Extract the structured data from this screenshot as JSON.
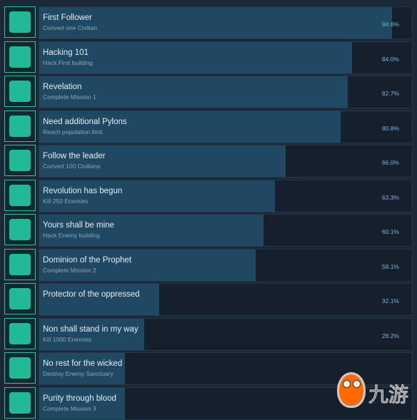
{
  "achievements": [
    {
      "title": "First Follower",
      "desc": "Convert one Civilian",
      "percent_label": "94.6%",
      "percent": 94.6,
      "icon": "spiral-head-icon"
    },
    {
      "title": "Hacking 101",
      "desc": "Hack First building",
      "percent_label": "84.0%",
      "percent": 84.0,
      "icon": "usb-stick-icon"
    },
    {
      "title": "Revelation",
      "desc": "Complete Mission 1",
      "percent_label": "82.7%",
      "percent": 82.7,
      "icon": "prophet-icon"
    },
    {
      "title": "Need additional Pylons",
      "desc": "Reach population limit",
      "percent_label": "80.8%",
      "percent": 80.8,
      "icon": "population-icon"
    },
    {
      "title": "Follow the leader",
      "desc": "Convert 100 Civilians",
      "percent_label": "66.0%",
      "percent": 66.0,
      "icon": "leader-icon"
    },
    {
      "title": "Revolution has begun",
      "desc": "Kill 250 Enemies",
      "percent_label": "63.3%",
      "percent": 63.3,
      "icon": "fist-icon"
    },
    {
      "title": "Yours shall be mine",
      "desc": "Hack Enemy building",
      "percent_label": "60.1%",
      "percent": 60.1,
      "icon": "chevron-shield-icon"
    },
    {
      "title": "Dominion of the Prophet",
      "desc": "Complete Mission 2",
      "percent_label": "58.1%",
      "percent": 58.1,
      "icon": "dominion-icon"
    },
    {
      "title": "Protector of the oppressed",
      "desc": "",
      "percent_label": "32.1%",
      "percent": 32.1,
      "icon": "protector-icon"
    },
    {
      "title": "Non shall stand in my way",
      "desc": "Kill 1000 Enemies",
      "percent_label": "28.2%",
      "percent": 28.2,
      "icon": "warrior-icon"
    },
    {
      "title": "No rest for the wicked",
      "desc": "Destroy Enemy Sanctuary",
      "percent_label": "",
      "percent": 23.0,
      "icon": "sanctuary-icon"
    },
    {
      "title": "Purity through blood",
      "desc": "Complete Mission 3",
      "percent_label": "",
      "percent": 23.0,
      "icon": "star-burst-icon"
    }
  ],
  "watermark": {
    "text": "九游"
  }
}
